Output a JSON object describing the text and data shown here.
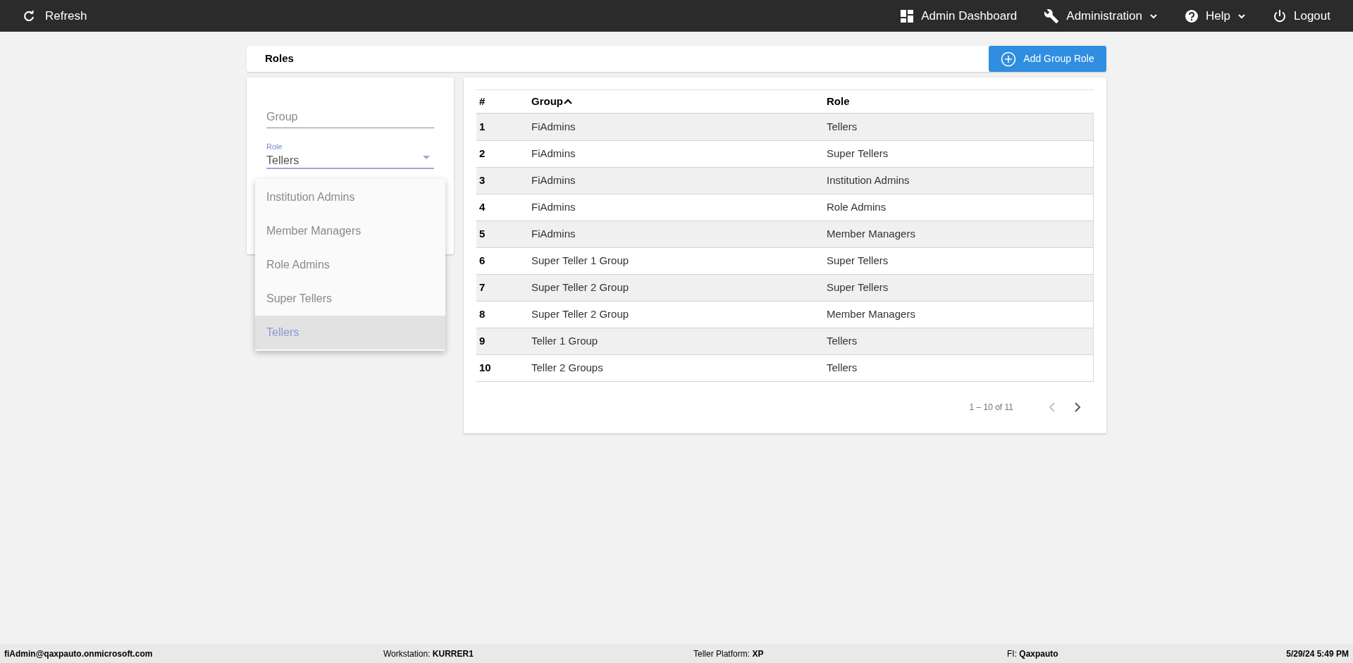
{
  "topbar": {
    "refresh": "Refresh",
    "links": [
      {
        "kind": "dashboard",
        "label": "Admin Dashboard",
        "dropdown": false
      },
      {
        "kind": "wrench",
        "label": "Administration",
        "dropdown": true
      },
      {
        "kind": "help",
        "label": "Help",
        "dropdown": true
      },
      {
        "kind": "power",
        "label": "Logout",
        "dropdown": false
      }
    ]
  },
  "page": {
    "title": "Roles",
    "add_button": "Add Group Role"
  },
  "filter": {
    "group": {
      "placeholder": "Group"
    },
    "role": {
      "label": "Role",
      "value": "Tellers"
    },
    "menu": [
      {
        "label": "Institution Admins",
        "selected": false
      },
      {
        "label": "Member Managers",
        "selected": false
      },
      {
        "label": "Role Admins",
        "selected": false
      },
      {
        "label": "Super Tellers",
        "selected": false
      },
      {
        "label": "Tellers",
        "selected": true
      }
    ]
  },
  "table": {
    "columns": [
      {
        "label": "#",
        "sorted": false
      },
      {
        "label": "Group",
        "sorted": true
      },
      {
        "label": "Role",
        "sorted": false
      }
    ],
    "rows": [
      [
        "1",
        "FiAdmins",
        "Tellers"
      ],
      [
        "2",
        "FiAdmins",
        "Super Tellers"
      ],
      [
        "3",
        "FiAdmins",
        "Institution Admins"
      ],
      [
        "4",
        "FiAdmins",
        "Role Admins"
      ],
      [
        "5",
        "FiAdmins",
        "Member Managers"
      ],
      [
        "6",
        "Super Teller 1 Group",
        "Super Tellers"
      ],
      [
        "7",
        "Super Teller 2 Group",
        "Super Tellers"
      ],
      [
        "8",
        "Super Teller 2 Group",
        "Member Managers"
      ],
      [
        "9",
        "Teller 1 Group",
        "Tellers"
      ],
      [
        "10",
        "Teller 2 Groups",
        "Tellers"
      ]
    ],
    "pagination": {
      "range": "1 – 10 of 11",
      "prev_disabled": true,
      "next_disabled": false
    }
  },
  "status_bar": {
    "user": "fiAdmin@qaxpauto.onmicrosoft.com",
    "items": [
      {
        "label": "Workstation:",
        "value": "KURRER1"
      },
      {
        "label": "Teller Platform:",
        "value": "XP"
      },
      {
        "label": "FI:",
        "value": "Qaxpauto"
      }
    ],
    "datetime": "5/29/24 5:49 PM"
  }
}
